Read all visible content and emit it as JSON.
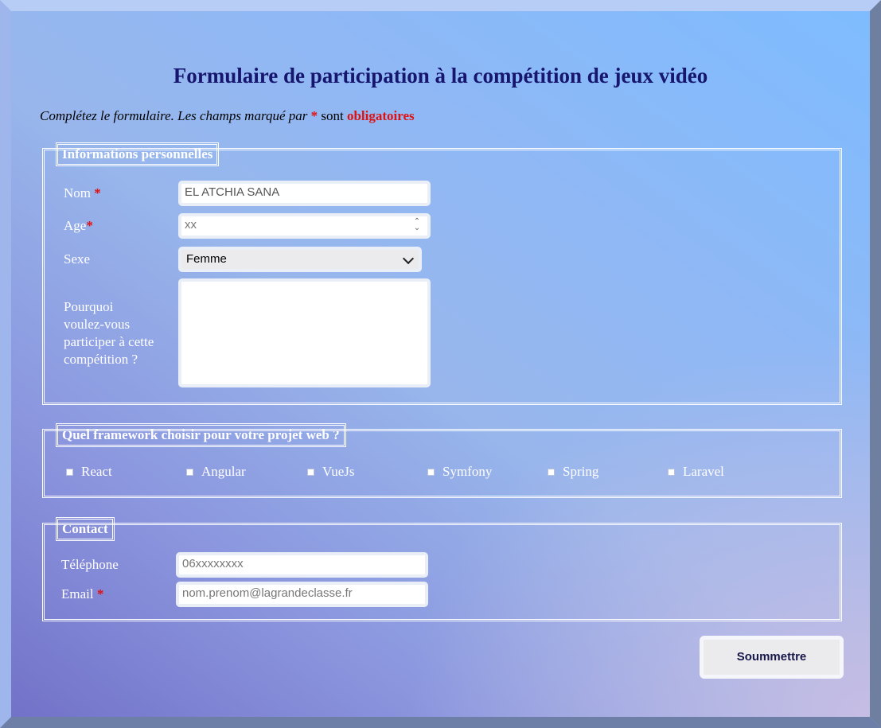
{
  "title": "Formulaire de participation à la compétition de jeux vidéo",
  "intro": {
    "text": "Complétez le formulaire. Les champs marqué par",
    "star": "*",
    "mid": "sont",
    "required": "obligatoires"
  },
  "personal": {
    "legend": "Informations personnelles",
    "nom_label": "Nom",
    "nom_star": "*",
    "nom_value": "EL ATCHIA SANA",
    "age_label": "Age",
    "age_star": "*",
    "age_placeholder": "xx",
    "sexe_label": "Sexe",
    "sexe_value": "Femme",
    "pourquoi_label_1": "Pourquoi",
    "pourquoi_label_2": "voulez-vous",
    "pourquoi_label_3": "participer à cette",
    "pourquoi_label_4": "compétition ?"
  },
  "framework": {
    "legend": "Quel framework choisir pour votre projet web ?",
    "options": [
      "React",
      "Angular",
      "VueJs",
      "Symfony",
      "Spring",
      "Laravel"
    ]
  },
  "contact": {
    "legend": "Contact",
    "tel_label": "Téléphone",
    "tel_placeholder": "06xxxxxxxx",
    "email_label": "Email",
    "email_star": "*",
    "email_placeholder": "nom.prenom@lagrandeclasse.fr"
  },
  "submit_label": "Soummettre",
  "colors": {
    "title": "#16166e",
    "required": "#e01111",
    "label": "#ffffff"
  }
}
